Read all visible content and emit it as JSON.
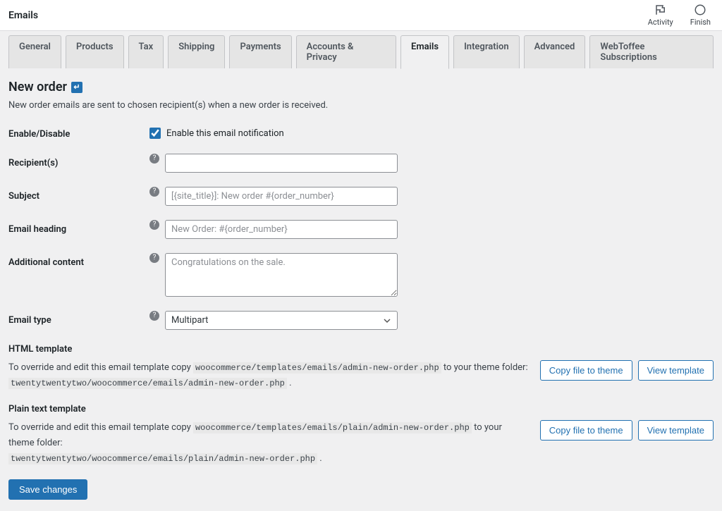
{
  "topbar": {
    "title": "Emails",
    "activity": "Activity",
    "finish": "Finish"
  },
  "tabs": [
    {
      "label": "General"
    },
    {
      "label": "Products"
    },
    {
      "label": "Tax"
    },
    {
      "label": "Shipping"
    },
    {
      "label": "Payments"
    },
    {
      "label": "Accounts & Privacy"
    },
    {
      "label": "Emails",
      "active": true
    },
    {
      "label": "Integration"
    },
    {
      "label": "Advanced"
    },
    {
      "label": "WebToffee Subscriptions"
    }
  ],
  "page": {
    "heading": "New order",
    "description": "New order emails are sent to chosen recipient(s) when a new order is received."
  },
  "form": {
    "enable_label": "Enable/Disable",
    "enable_checkbox_label": "Enable this email notification",
    "enable_checked": true,
    "recipients_label": "Recipient(s)",
    "recipients_value": "",
    "subject_label": "Subject",
    "subject_placeholder": "[{site_title}]: New order #{order_number}",
    "subject_value": "",
    "email_heading_label": "Email heading",
    "email_heading_placeholder": "New Order: #{order_number}",
    "email_heading_value": "",
    "additional_content_label": "Additional content",
    "additional_content_placeholder": "Congratulations on the sale.",
    "additional_content_value": "",
    "email_type_label": "Email type",
    "email_type_value": "Multipart"
  },
  "html_template": {
    "title": "HTML template",
    "prefix": "To override and edit this email template copy ",
    "src_path": "woocommerce/templates/emails/admin-new-order.php",
    "middle": " to your theme folder: ",
    "dst_path": "twentytwentytwo/woocommerce/emails/admin-new-order.php",
    "suffix": " .",
    "copy_btn": "Copy file to theme",
    "view_btn": "View template"
  },
  "plain_template": {
    "title": "Plain text template",
    "prefix": "To override and edit this email template copy ",
    "src_path": "woocommerce/templates/emails/plain/admin-new-order.php",
    "middle": " to your theme folder: ",
    "dst_path": "twentytwentytwo/woocommerce/emails/plain/admin-new-order.php",
    "suffix": " .",
    "copy_btn": "Copy file to theme",
    "view_btn": "View template"
  },
  "save_button": "Save changes"
}
